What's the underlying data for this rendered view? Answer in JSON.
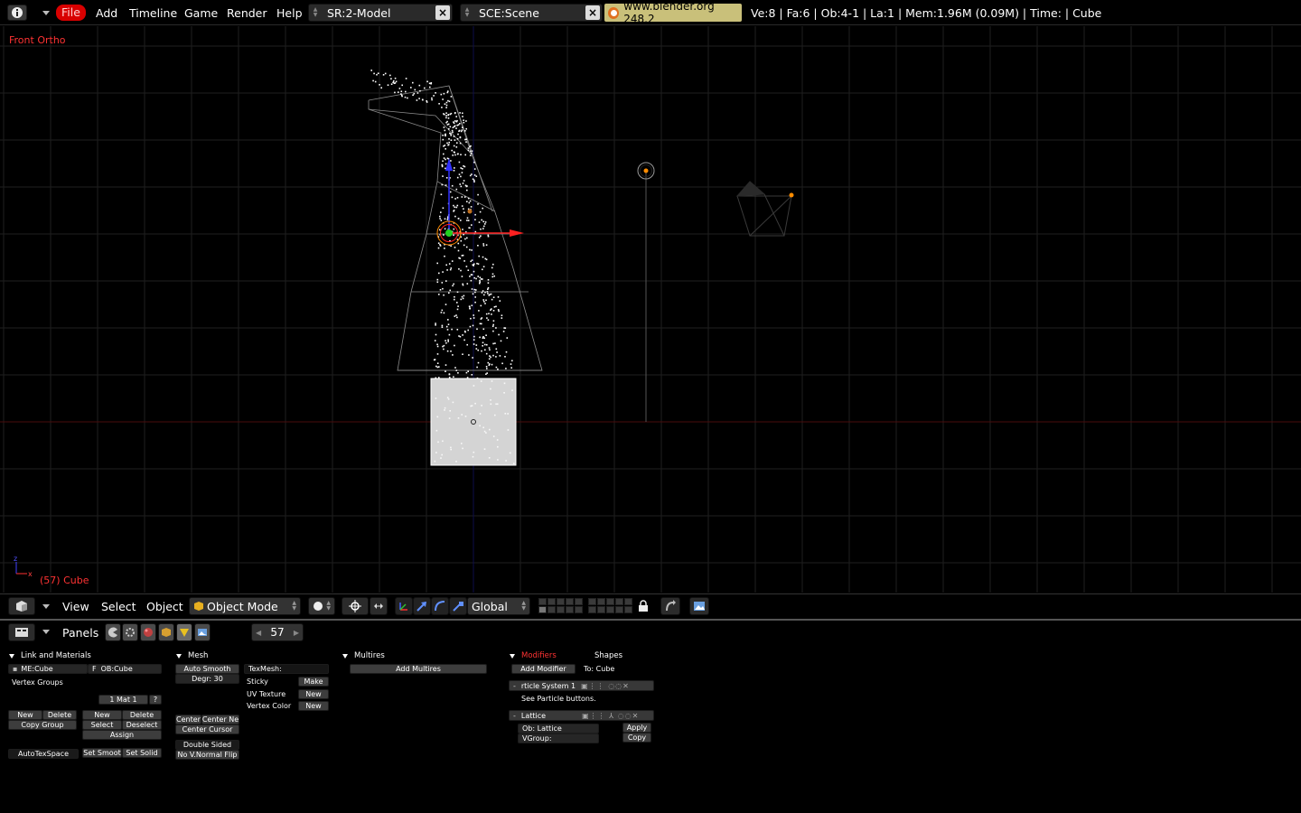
{
  "top_header": {
    "menus": [
      "File",
      "Add",
      "Timeline",
      "Game",
      "Render",
      "Help"
    ],
    "screen_field": "SR:2-Model",
    "scene_field": "SCE:Scene",
    "web_link": "www.blender.org 248.2",
    "stats": "Ve:8 | Fa:6 | Ob:4-1 | La:1  | Mem:1.96M (0.09M)  | Time: | Cube"
  },
  "viewport": {
    "view_name": "Front Ortho",
    "active_object": "(57) Cube",
    "axis_labels": {
      "z": "z",
      "x": "x"
    },
    "colors": {
      "grid": "#1f1f1f",
      "axis_x": "#5a0a0a",
      "axis_z": "#0a0a5a",
      "wire": "#8a8a8a",
      "cube": "#d4d4d4",
      "manip_x": "#ff2020",
      "manip_z": "#3030ff",
      "center": "#20d020",
      "selection": "#ff8c00"
    }
  },
  "view_header": {
    "menus": [
      "View",
      "Select",
      "Object"
    ],
    "mode": "Object Mode",
    "orientation": "Global"
  },
  "buttons_header": {
    "panels_label": "Panels",
    "frame": "57"
  },
  "panels": {
    "link_materials": {
      "title": "Link and Materials",
      "me_field": "ME:Cube",
      "ob_field_flag": "F",
      "ob_field": "OB:Cube",
      "vertex_groups": "Vertex Groups",
      "mat_field": "1 Mat 1",
      "mat_q": "?",
      "vg_new": "New",
      "vg_delete": "Delete",
      "vg_copy": "Copy Group",
      "mat_new": "New",
      "mat_delete": "Delete",
      "mat_select": "Select",
      "mat_deselect": "Deselect",
      "mat_assign": "Assign",
      "autotexspace": "AutoTexSpace",
      "set_smooth": "Set Smoot",
      "set_solid": "Set Solid"
    },
    "mesh": {
      "title": "Mesh",
      "auto_smooth": "Auto Smooth",
      "degr": "Degr: 30",
      "texmesh": "TexMesh:",
      "sticky": "Sticky",
      "sticky_btn": "Make",
      "uv_texture": "UV Texture",
      "uv_btn": "New",
      "vertex_color": "Vertex Color",
      "vc_btn": "New",
      "center": "Center",
      "center_new": "Center Ne",
      "center_cursor": "Center Cursor",
      "double_sided": "Double Sided",
      "no_vnormal": "No V.Normal Flip"
    },
    "multires": {
      "title": "Multires",
      "add_multires": "Add Multires"
    },
    "modifiers": {
      "title": "Modifiers",
      "shapes_tab": "Shapes",
      "add_modifier": "Add Modifier",
      "to": "To: Cube",
      "particle_system": "rticle System 1",
      "particle_note": "See Particle buttons.",
      "lattice": "Lattice",
      "ob_lattice": "Ob: Lattice",
      "vgroup": "VGroup:",
      "apply": "Apply",
      "copy": "Copy"
    }
  }
}
